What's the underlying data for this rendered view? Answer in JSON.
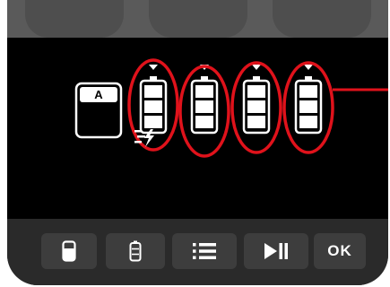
{
  "display": {
    "profile_letter": "A",
    "battery_count": 4,
    "charging_indicator_icon": "fast-charge-icon",
    "highlight_color": "#e0121b",
    "active_indicator": "triangle-down-icon"
  },
  "buttons": [
    {
      "name": "battery-menu-button",
      "icon": "battery-icon"
    },
    {
      "name": "cell-menu-button",
      "icon": "cell-icon"
    },
    {
      "name": "list-menu-button",
      "icon": "list-icon"
    },
    {
      "name": "play-pause-button",
      "icon": "play-pause-icon"
    },
    {
      "name": "ok-button",
      "label": "OK"
    }
  ]
}
